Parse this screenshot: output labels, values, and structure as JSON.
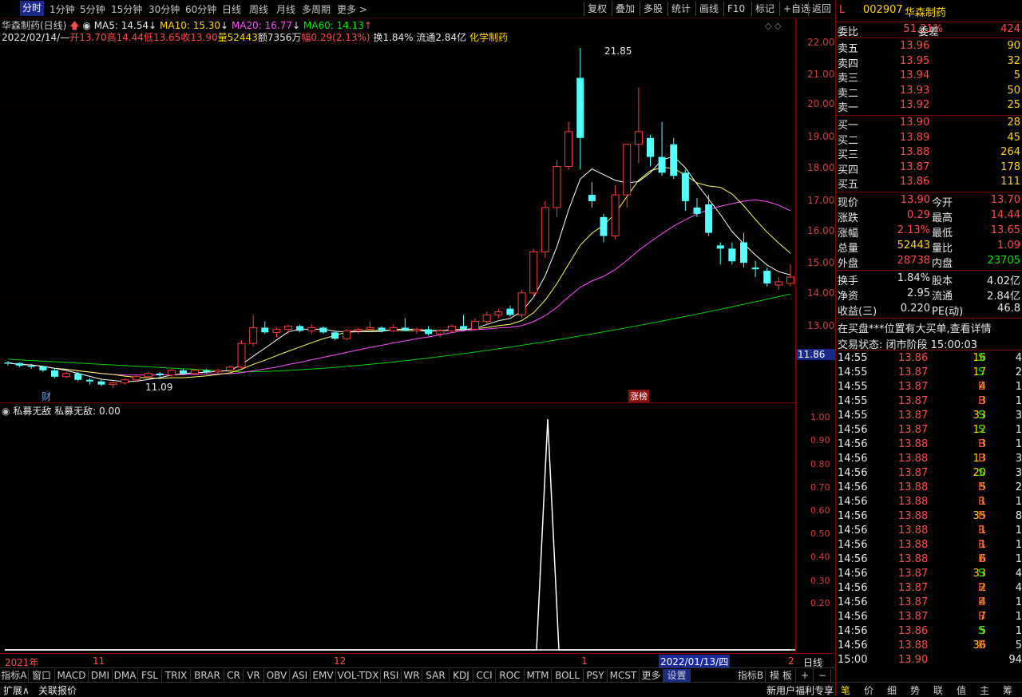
{
  "toolbar": {
    "timeframes": [
      "分时",
      "1分钟",
      "5分钟",
      "15分钟",
      "30分钟",
      "60分钟",
      "日线",
      "周线",
      "月线",
      "多周期",
      "更多 >"
    ],
    "buttons": [
      "复权",
      "叠加",
      "多股",
      "统计",
      "画线",
      "F10",
      "标记",
      "+自选",
      "返回"
    ]
  },
  "chart": {
    "title": "华森制药(日线)",
    "ma5": "MA5: 14.54",
    "ma10": "MA10: 15.30",
    "ma20": "MA20: 16.77",
    "ma60": "MA60: 14.13",
    "bar_date": "2022/02/14/—",
    "open": "开13.70",
    "high": "高14.44",
    "low": "低13.65",
    "close": "收13.90",
    "volume": "量52443",
    "amount": "额7356万",
    "change": "幅0.29(2.13%)",
    "turnover": "换1.84%",
    "float": "流通2.84亿",
    "sector": "化学制药",
    "max_label": "21.85",
    "min_label": "11.09",
    "cursor_price": "11.86",
    "marker_cai": "财",
    "marker_zhangbang": "涨榜",
    "y_ticks": [
      "22.00",
      "21.00",
      "20.00",
      "19.00",
      "18.00",
      "17.00",
      "16.00",
      "15.00",
      "14.00",
      "13.00"
    ]
  },
  "indicator": {
    "name": "私募无敌",
    "value_text": "私募无敌: 0.00",
    "y_ticks": [
      "1.00",
      "0.90",
      "0.80",
      "0.70",
      "0.60",
      "0.50",
      "0.40",
      "0.30",
      "0.20"
    ]
  },
  "timeline": {
    "labels": [
      "2021年",
      "11",
      "12",
      "1",
      "2"
    ],
    "cursor_date": "2022/01/13/四",
    "period": "日线"
  },
  "tabs": [
    "指标A",
    "窗口",
    "MACD",
    "DMI",
    "DMA",
    "FSL",
    "TRIX",
    "BRAR",
    "CR",
    "VR",
    "OBV",
    "ASI",
    "EMV",
    "VOL-TDX",
    "RSI",
    "WR",
    "SAR",
    "KDJ",
    "CCI",
    "ROC",
    "MTM",
    "BOLL",
    "PSY",
    "MCST",
    "更多",
    "设置"
  ],
  "tabs_right": [
    "指标B",
    "模 板",
    "+",
    "−"
  ],
  "status_left": [
    "扩展∧",
    "关联报价"
  ],
  "status_right": "新用户福利专享",
  "quote": {
    "flag": "L",
    "code": "002907",
    "name": "华森制药",
    "weibi_label": "委比",
    "weibi": "51.21%",
    "weicha_label": "委差",
    "weicha": "424",
    "asks": [
      {
        "label": "卖五",
        "price": "13.96",
        "vol": "90"
      },
      {
        "label": "卖四",
        "price": "13.95",
        "vol": "32"
      },
      {
        "label": "卖三",
        "price": "13.94",
        "vol": "5"
      },
      {
        "label": "卖二",
        "price": "13.93",
        "vol": "50"
      },
      {
        "label": "卖一",
        "price": "13.92",
        "vol": "25"
      }
    ],
    "bids": [
      {
        "label": "买一",
        "price": "13.90",
        "vol": "28"
      },
      {
        "label": "买二",
        "price": "13.89",
        "vol": "45"
      },
      {
        "label": "买三",
        "price": "13.88",
        "vol": "264"
      },
      {
        "label": "买四",
        "price": "13.87",
        "vol": "178"
      },
      {
        "label": "买五",
        "price": "13.86",
        "vol": "111"
      }
    ],
    "stats": [
      {
        "l1": "现价",
        "v1": "13.90",
        "l2": "今开",
        "v2": "13.70"
      },
      {
        "l1": "涨跌",
        "v1": "0.29",
        "l2": "最高",
        "v2": "14.44"
      },
      {
        "l1": "涨幅",
        "v1": "2.13%",
        "l2": "最低",
        "v2": "13.65"
      },
      {
        "l1": "总量",
        "v1": "52443",
        "l2": "量比",
        "v2": "1.09"
      },
      {
        "l1": "外盘",
        "v1": "28738",
        "l2": "内盘",
        "v2": "23705"
      }
    ],
    "stats2": [
      {
        "l1": "换手",
        "v1": "1.84%",
        "l2": "股本",
        "v2": "4.02亿"
      },
      {
        "l1": "净资",
        "v1": "2.95",
        "l2": "流通",
        "v2": "2.84亿"
      },
      {
        "l1": "收益(三)",
        "v1": "0.220",
        "l2": "PE(动)",
        "v2": "46.8"
      }
    ],
    "notice": "在买盘***位置有大买单,查看详情",
    "trade_state": "交易状态: 闭市阶段 15:00:03",
    "ticks": [
      {
        "t": "14:55",
        "p": "13.86",
        "v": "16",
        "s": "S",
        "n": "4"
      },
      {
        "t": "14:55",
        "p": "13.87",
        "v": "17",
        "s": "S",
        "n": "2"
      },
      {
        "t": "14:55",
        "p": "13.87",
        "v": "4",
        "s": "B",
        "n": "1"
      },
      {
        "t": "14:55",
        "p": "13.87",
        "v": "3",
        "s": "B",
        "n": "1"
      },
      {
        "t": "14:55",
        "p": "13.87",
        "v": "33",
        "s": "S",
        "n": "3"
      },
      {
        "t": "14:56",
        "p": "13.87",
        "v": "12",
        "s": "S",
        "n": "1"
      },
      {
        "t": "14:56",
        "p": "13.88",
        "v": "3",
        "s": "B",
        "n": "1"
      },
      {
        "t": "14:56",
        "p": "13.88",
        "v": "13",
        "s": "B",
        "n": "3"
      },
      {
        "t": "14:56",
        "p": "13.87",
        "v": "20",
        "s": "S",
        "n": "3"
      },
      {
        "t": "14:56",
        "p": "13.88",
        "v": "5",
        "s": "B",
        "n": "2"
      },
      {
        "t": "14:56",
        "p": "13.88",
        "v": "1",
        "s": "B",
        "n": "1"
      },
      {
        "t": "14:56",
        "p": "13.88",
        "v": "35",
        "s": "B",
        "n": "8"
      },
      {
        "t": "14:56",
        "p": "13.88",
        "v": "1",
        "s": "B",
        "n": "1"
      },
      {
        "t": "14:56",
        "p": "13.88",
        "v": "1",
        "s": "B",
        "n": "1"
      },
      {
        "t": "14:56",
        "p": "13.88",
        "v": "6",
        "s": "B",
        "n": "1"
      },
      {
        "t": "14:56",
        "p": "13.87",
        "v": "33",
        "s": "S",
        "n": "4"
      },
      {
        "t": "14:56",
        "p": "13.87",
        "v": "2",
        "s": "B",
        "n": "4"
      },
      {
        "t": "14:56",
        "p": "13.87",
        "v": "4",
        "s": "B",
        "n": "1"
      },
      {
        "t": "14:56",
        "p": "13.87",
        "v": "7",
        "s": "B",
        "n": "1"
      },
      {
        "t": "14:56",
        "p": "13.86",
        "v": "5",
        "s": "S",
        "n": "1"
      },
      {
        "t": "14:56",
        "p": "13.88",
        "v": "36",
        "s": "B",
        "n": "5"
      },
      {
        "t": "15:00",
        "p": "13.90",
        "v": "",
        "s": "",
        "n": "94"
      }
    ],
    "bottom_tabs": [
      "笔",
      "价",
      "细",
      "势",
      "联",
      "值",
      "主",
      "筹"
    ]
  },
  "colors": {
    "up": "#ff3c3c",
    "down": "#54ffff",
    "ma5": "#ffffff",
    "ma10": "#ffff60",
    "ma20": "#ff50ff",
    "ma60": "#00d000",
    "axis": "#7a0000"
  }
}
